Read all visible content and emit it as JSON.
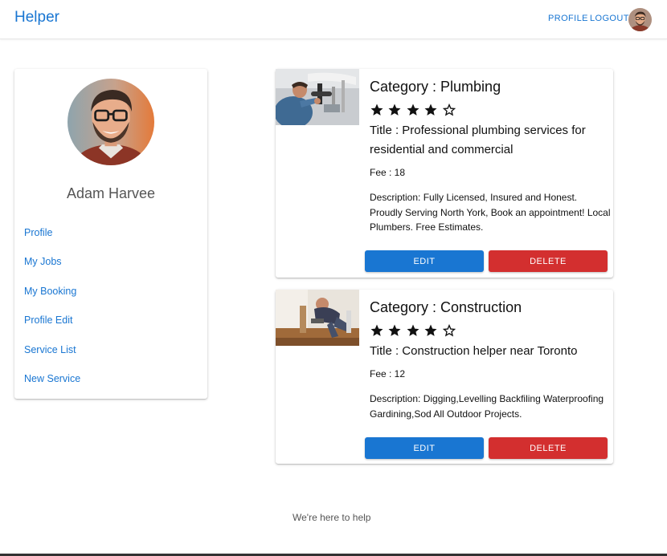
{
  "app": {
    "brand": "Helper"
  },
  "nav": {
    "profile": "PROFILE",
    "logout": "LOGOUT"
  },
  "profile": {
    "name": "Adam Harvee"
  },
  "sidebar": {
    "items": [
      {
        "label": "Profile"
      },
      {
        "label": "My Jobs"
      },
      {
        "label": "My Booking"
      },
      {
        "label": "Profile Edit"
      },
      {
        "label": "Service List"
      },
      {
        "label": "New Service"
      }
    ]
  },
  "services": [
    {
      "category": "Category : Plumbing",
      "rating": 4,
      "rating_max": 5,
      "title": "Title : Professional plumbing services for residential and commercial",
      "fee": "Fee : 18",
      "description": "Description: Fully Licensed, Insured and Honest. Proudly Serving North York, Book an appointment! Local Plumbers. Free Estimates.",
      "edit_label": "EDIT",
      "delete_label": "DELETE"
    },
    {
      "category": "Category : Construction",
      "rating": 4,
      "rating_max": 5,
      "title": "Title : Construction helper near Toronto",
      "fee": "Fee : 12",
      "description": "Description: Digging,Levelling Backfiling Waterproofing Gardining,Sod All Outdoor Projects.",
      "edit_label": "EDIT",
      "delete_label": "DELETE"
    }
  ],
  "footer": {
    "text": "We're here to help"
  },
  "colors": {
    "primary": "#1976d2",
    "danger": "#d32f2f"
  }
}
